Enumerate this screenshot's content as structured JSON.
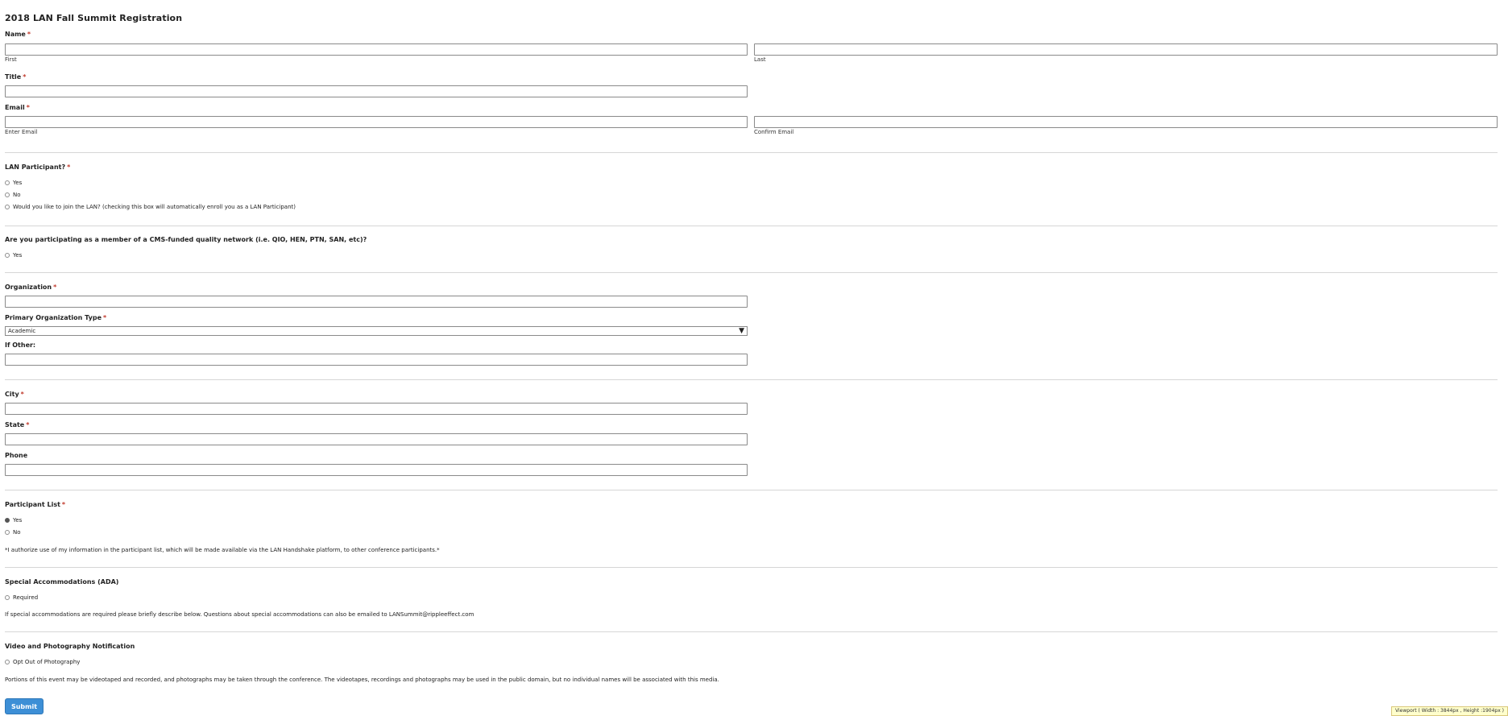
{
  "form": {
    "title": "2018 LAN Fall Summit Registration",
    "required_mark": "*",
    "name": {
      "label": "Name",
      "first_sub": "First",
      "last_sub": "Last"
    },
    "title_field": {
      "label": "Title"
    },
    "email": {
      "label": "Email",
      "enter_sub": "Enter Email",
      "confirm_sub": "Confirm Email"
    },
    "lan_participant": {
      "label": "LAN Participant?",
      "options": [
        "Yes",
        "No",
        "Would you like to join the LAN? (checking this box will automatically enroll you as a LAN Participant)"
      ]
    },
    "cms_network": {
      "label": "Are you participating as a member of a CMS-funded quality network (i.e. QIO, HEN, PTN, SAN, etc)?",
      "options": [
        "Yes"
      ]
    },
    "organization": {
      "label": "Organization"
    },
    "org_type": {
      "label": "Primary Organization Type",
      "selected": "Academic",
      "arrow": "▼"
    },
    "if_other": {
      "label": "If Other:"
    },
    "city": {
      "label": "City"
    },
    "state": {
      "label": "State"
    },
    "phone": {
      "label": "Phone"
    },
    "participant_list": {
      "label": "Participant List",
      "options": [
        "Yes",
        "No"
      ],
      "selected": "Yes",
      "note": "*I authorize use of my information in the participant list, which will be made available via the LAN Handshake platform, to other conference participants.*"
    },
    "ada": {
      "label": "Special Accommodations (ADA)",
      "options": [
        "Required"
      ],
      "note": "If special accommodations are required please briefly describe below. Questions about special accommodations can also be emailed to LANSummit@rippleeffect.com"
    },
    "video": {
      "label": "Video and Photography Notification",
      "options": [
        "Opt Out of Photography"
      ],
      "note": "Portions of this event may be videotaped and recorded, and photographs may be taken through the conference. The videotapes, recordings and photographs may be used in the public domain, but no individual names will be associated with this media."
    },
    "submit_label": "Submit"
  },
  "viewport_badge": "Viewport ( Width : 3844px , Height :1904px )",
  "colors": {
    "accent": "#3d8fd6",
    "required": "#c0392b",
    "divider": "#d6d6d6"
  }
}
